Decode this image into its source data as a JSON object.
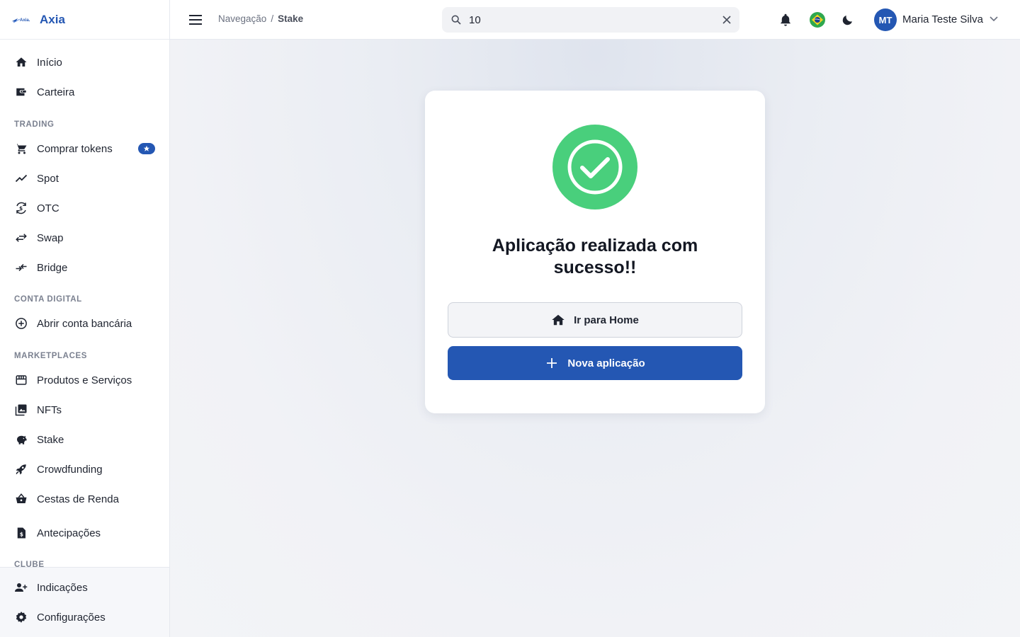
{
  "app": {
    "name": "Axia",
    "logo_text": "Axia."
  },
  "colors": {
    "primary": "#2457b3",
    "success": "#49cf7c",
    "background": "#eef1f6"
  },
  "sidebar": {
    "items_top": [
      {
        "label": "Início",
        "icon": "home-icon"
      },
      {
        "label": "Carteira",
        "icon": "wallet-icon"
      }
    ],
    "sections": [
      {
        "title": "TRADING",
        "items": [
          {
            "label": "Comprar tokens",
            "icon": "cart-icon",
            "badge": "star-icon"
          },
          {
            "label": "Spot",
            "icon": "trending-up-icon"
          },
          {
            "label": "OTC",
            "icon": "currency-exchange-icon"
          },
          {
            "label": "Swap",
            "icon": "swap-arrows-icon"
          },
          {
            "label": "Bridge",
            "icon": "bridge-arrows-icon"
          }
        ]
      },
      {
        "title": "CONTA DIGITAL",
        "items": [
          {
            "label": "Abrir conta bancária",
            "icon": "add-circle-icon"
          }
        ]
      },
      {
        "title": "MARKETPLACES",
        "items": [
          {
            "label": "Produtos e Serviços",
            "icon": "storefront-icon"
          },
          {
            "label": "NFTs",
            "icon": "image-collection-icon"
          },
          {
            "label": "Stake",
            "icon": "piggy-bank-icon"
          },
          {
            "label": "Crowdfunding",
            "icon": "rocket-icon"
          },
          {
            "label": "Cestas de Renda",
            "icon": "basket-icon"
          },
          {
            "label": "Antecipações",
            "icon": "receipt-dollar-icon"
          }
        ]
      },
      {
        "title": "CLUBE",
        "items": []
      }
    ],
    "items_bottom": [
      {
        "label": "Indicações",
        "icon": "person-add-icon"
      },
      {
        "label": "Configurações",
        "icon": "gear-icon"
      }
    ]
  },
  "header": {
    "breadcrumb": {
      "root": "Navegação",
      "separator": "/",
      "current": "Stake"
    },
    "search": {
      "value": "10",
      "placeholder": ""
    },
    "language_flag": "brazil-flag-icon",
    "user": {
      "initials": "MT",
      "name": "Maria Teste Silva"
    }
  },
  "result_card": {
    "title": "Aplicação realizada com sucesso!!",
    "home_button": "Ir para Home",
    "new_button": "Nova aplicação"
  }
}
